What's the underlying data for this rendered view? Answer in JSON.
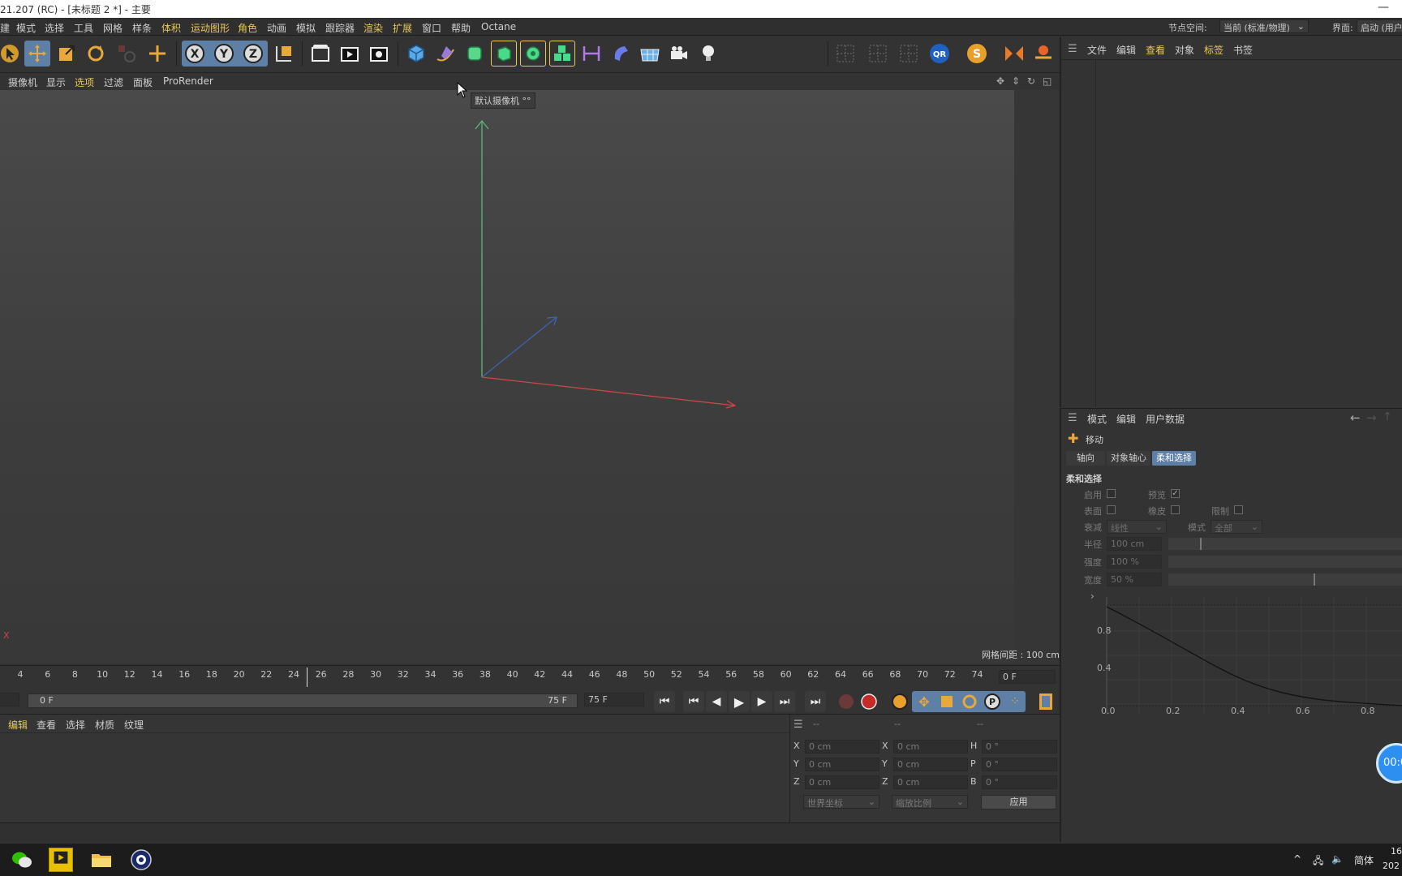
{
  "window": {
    "title": "21.207 (RC) - [未标题 2 *] - 主要",
    "minimize_glyph": "—"
  },
  "menubar": {
    "items": [
      "模式",
      "选择",
      "工具",
      "网格",
      "样条",
      "体积",
      "运动图形",
      "角色",
      "动画",
      "模拟",
      "跟踪器",
      "渲染",
      "扩展",
      "窗口",
      "帮助",
      "Octane"
    ],
    "highlighted": [
      "体积",
      "运动图形",
      "角色",
      "渲染",
      "扩展"
    ],
    "node_space_label": "节点空间:",
    "node_space_value": "当前 (标准/物理)",
    "layout_label": "界面:",
    "layout_value": "启动 (用户"
  },
  "toolbar": {
    "icons": [
      "select-arrow-icon",
      "move-icon",
      "scale-icon",
      "rotate-icon",
      "recent-tools-icon",
      "add-icon",
      "x-axis-lock-icon",
      "y-axis-lock-icon",
      "z-axis-lock-icon",
      "coordinate-system-icon",
      "render-region-icon",
      "render-view-icon",
      "render-settings-icon",
      "cube-primitive-icon",
      "pen-spline-icon",
      "subdivision-icon",
      "extrude-icon",
      "cloner-icon",
      "array-icon",
      "dimension-icon",
      "deformer-icon",
      "floor-icon",
      "camera-icon",
      "light-icon",
      "snap-grid-1-icon",
      "snap-grid-2-icon",
      "snap-grid-3-icon",
      "qr-plugin-icon",
      "s-plugin-icon",
      "symmetry-icon",
      "workplane-icon"
    ]
  },
  "viewport_menu": {
    "items": [
      "摄像机",
      "显示",
      "选项",
      "过滤",
      "面板",
      "ProRender"
    ],
    "highlighted": "选项"
  },
  "viewport": {
    "tooltip": "默认摄像机 °°",
    "grid_info": "网格间距 : 100 cm",
    "axis_x_label": "X",
    "colors": {
      "x_axis": "#c84848",
      "y_axis": "#5ab878",
      "z_axis": "#3c64b4"
    }
  },
  "timeline": {
    "ticks": [
      "4",
      "6",
      "8",
      "10",
      "12",
      "14",
      "16",
      "18",
      "20",
      "22",
      "24",
      "26",
      "28",
      "30",
      "32",
      "34",
      "36",
      "38",
      "40",
      "42",
      "44",
      "46",
      "48",
      "50",
      "52",
      "54",
      "56",
      "58",
      "60",
      "62",
      "64",
      "66",
      "68",
      "70",
      "72",
      "74"
    ],
    "current_frame": "0 F",
    "range_start": "0 F",
    "range_end": "75 F",
    "end_field": "75 F"
  },
  "material_panel": {
    "items": [
      "编辑",
      "查看",
      "选择",
      "材质",
      "纹理"
    ],
    "highlighted": "编辑"
  },
  "coordinates": {
    "col_headers": [
      "--",
      "--",
      "--"
    ],
    "rows": [
      {
        "l1": "X",
        "v1": "0 cm",
        "l2": "X",
        "v2": "0 cm",
        "l3": "H",
        "v3": "0 °"
      },
      {
        "l1": "Y",
        "v1": "0 cm",
        "l2": "Y",
        "v2": "0 cm",
        "l3": "P",
        "v3": "0 °"
      },
      {
        "l1": "Z",
        "v1": "0 cm",
        "l2": "Z",
        "v2": "0 cm",
        "l3": "B",
        "v3": "0 °"
      }
    ],
    "world_coords": "世界坐标",
    "scale_ratio": "缩放比例",
    "apply": "应用"
  },
  "object_panel": {
    "items": [
      "文件",
      "编辑",
      "查看",
      "对象",
      "标签",
      "书签"
    ],
    "highlighted": "标签"
  },
  "attributes": {
    "menu": [
      "模式",
      "编辑",
      "用户数据"
    ],
    "tool_name": "移动",
    "tabs": [
      "轴向",
      "对象轴心",
      "柔和选择"
    ],
    "active_tab": "柔和选择",
    "section": "柔和选择",
    "enable_label": "启用",
    "preview_label": "预览",
    "surface_label": "表面",
    "rubber_label": "橡皮",
    "limit_label": "限制",
    "falloff_label": "衰减",
    "falloff_value": "线性",
    "mode_label": "模式",
    "mode_value": "全部",
    "radius_label": "半径",
    "radius_value": "100 cm",
    "strength_label": "强度",
    "strength_value": "100 %",
    "width_label": "宽度",
    "width_value": "50 %",
    "graph": {
      "y_labels": [
        "0.8",
        "0.4"
      ],
      "x_labels": [
        "0.0",
        "0.2",
        "0.4",
        "0.6",
        "0.8"
      ],
      "expand_glyph": "›"
    }
  },
  "timer": "00:0",
  "taskbar": {
    "lang": "简体",
    "clock_top": "16",
    "clock_bottom": "202"
  }
}
